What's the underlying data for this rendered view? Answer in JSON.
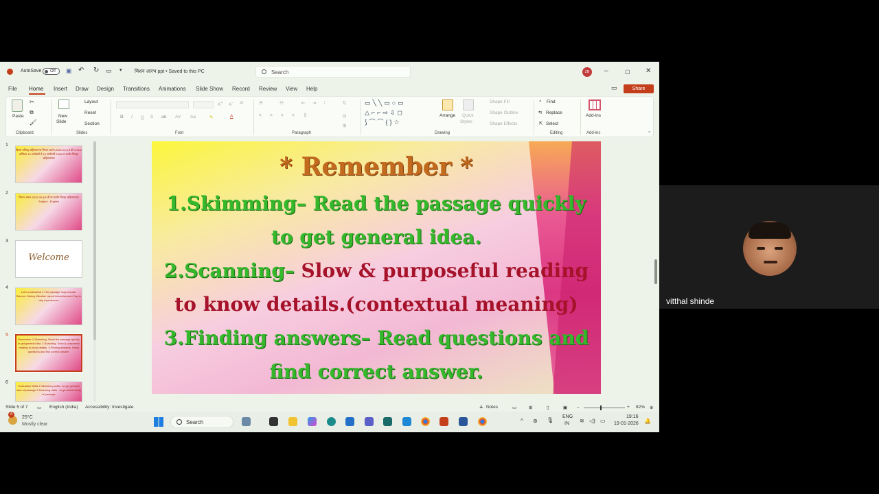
{
  "titlebar": {
    "autosave_label": "AutoSave",
    "autosave_state": "Off",
    "doc_title": "मिशन आरंभ ppt • Saved to this PC",
    "search_placeholder": "Search",
    "user_initials": "ZB"
  },
  "menu": {
    "tabs": [
      "File",
      "Home",
      "Insert",
      "Draw",
      "Design",
      "Transitions",
      "Animations",
      "Slide Show",
      "Record",
      "Review",
      "View",
      "Help"
    ],
    "active": "Home",
    "share": "Share"
  },
  "ribbon": {
    "clipboard": {
      "paste": "Paste",
      "group": "Clipboard"
    },
    "slides": {
      "new_slide": "New",
      "new_slide2": "Slide",
      "layout": "Layout",
      "reset": "Reset",
      "section": "Section",
      "group": "Slides"
    },
    "font": {
      "group": "Font"
    },
    "paragraph": {
      "group": "Paragraph"
    },
    "drawing": {
      "arrange": "Arrange",
      "quick_styles": "Quick",
      "quick_styles2": "Styles",
      "shape_fill": "Shape Fill",
      "shape_outline": "Shape Outline",
      "shape_effects": "Shape Effects",
      "group": "Drawing"
    },
    "editing": {
      "find": "Find",
      "replace": "Replace",
      "select": "Select",
      "group": "Editing"
    },
    "addins": {
      "label": "Add-ins",
      "group": "Add-ins"
    }
  },
  "thumbnails": [
    {
      "num": "1",
      "text": "विलय परिषद् अहिल्यानगर\nमिशन आरंभ-2025-26 इ.8 वी\nOnline तासिका\n15 जानेवारी ते 19 जानेवारी 2026\nता.कर्जत जिल्हा अहिल्यानगर"
    },
    {
      "num": "2",
      "text": "मिशन आरंभ-2025-26\nइ.8 वी\nता.कर्जत जिल्हा अहिल्यानगर\nSubject - English"
    },
    {
      "num": "3",
      "text": "Welcome"
    },
    {
      "num": "4",
      "text": "Let's understand\n1.The passage may include-\nScience\nHistory\nWeather report\nAdvertisement\nDay to day experiences"
    },
    {
      "num": "5",
      "text": "Remember\n1.Skimming- Read the passage quickly to get general idea.\n2.Scanning- Slow & purposeful reading to know details.\n3.Finding answers- Read questions and find correct answer."
    },
    {
      "num": "6",
      "text": "Evaluation Skills\n1.Skimming skills - to get general idea of passage\n2.Scanning skills - to get detail study of passage"
    }
  ],
  "slide": {
    "title": "* Remember *",
    "line1a": "1.Skimming– ",
    "line1b": "Read the passage quickly",
    "line1c": "to get general idea.",
    "line2a": "2.Scanning– ",
    "line2b": "Slow & purposeful reading",
    "line2c": "to know details.(contextual meaning)",
    "line3a": "3.Finding answers– ",
    "line3b": "Read questions and",
    "line3c": "find correct answer."
  },
  "status": {
    "slide_of": "Slide 5 of 7",
    "language": "English (India)",
    "accessibility": "Accessibility: Investigate",
    "notes": "Notes",
    "zoom": "82%"
  },
  "taskbar": {
    "temp": "25°C",
    "weather": "Mostly clear",
    "search": "Search",
    "lang1": "ENG",
    "lang2": "IN",
    "time": "19:16",
    "date": "19-01-2026",
    "badge": "4"
  },
  "video": {
    "name": "vitthal shinde"
  },
  "colors": {
    "accent": "#c43e1c",
    "slide_green": "#35b82c",
    "slide_red": "#a5122a",
    "slide_orange": "#c26a1e"
  }
}
